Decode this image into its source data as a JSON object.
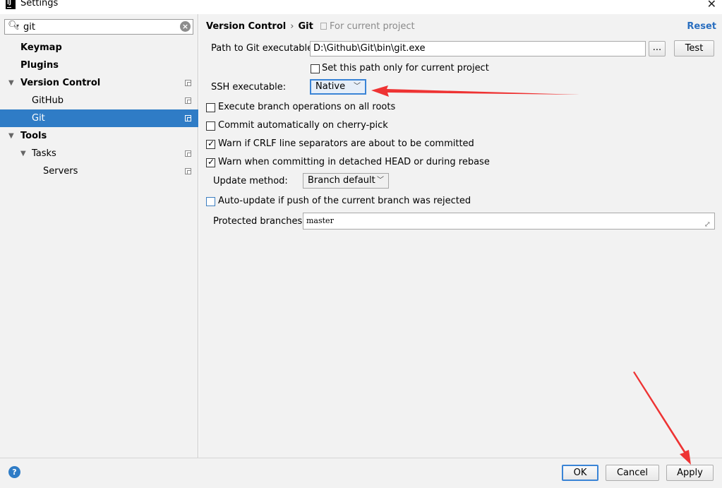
{
  "window": {
    "title": "Settings",
    "app_icon": "intellij-icon",
    "close_icon": "close-icon"
  },
  "search": {
    "value": "git"
  },
  "sidebar": {
    "items": [
      {
        "label": "Keymap"
      },
      {
        "label": "Plugins"
      },
      {
        "label": "Version Control"
      },
      {
        "label": "GitHub"
      },
      {
        "label": "Git"
      },
      {
        "label": "Tools"
      },
      {
        "label": "Tasks"
      },
      {
        "label": "Servers"
      }
    ],
    "selected": "Git"
  },
  "header": {
    "breadcrumb_parent": "Version Control",
    "breadcrumb_current": "Git",
    "scope": "For current project",
    "reset": "Reset"
  },
  "git": {
    "path_label": "Path to Git executable:",
    "path_value": "D:\\Github\\Git\\bin\\git.exe",
    "browse": "...",
    "test": "Test",
    "this_project_only": {
      "label": "Set this path only for current project",
      "checked": false
    },
    "ssh_label": "SSH executable:",
    "ssh_value": "Native",
    "options": [
      {
        "label": "Execute branch operations on all roots",
        "checked": false
      },
      {
        "label": "Commit automatically on cherry-pick",
        "checked": false
      },
      {
        "label": "Warn if CRLF line separators are about to be committed",
        "checked": true
      },
      {
        "label": "Warn when committing in detached HEAD or during rebase",
        "checked": true
      }
    ],
    "update_method_label": "Update method:",
    "update_method_value": "Branch default",
    "auto_update": {
      "label": "Auto-update if push of the current branch was rejected",
      "checked": false
    },
    "protected_label": "Protected branches:",
    "protected_value": "master"
  },
  "footer": {
    "ok": "OK",
    "cancel": "Cancel",
    "apply": "Apply"
  },
  "colors": {
    "selection": "#2f7cc6",
    "annotation_arrow": "#ee3333",
    "link": "#2a6fc0"
  }
}
